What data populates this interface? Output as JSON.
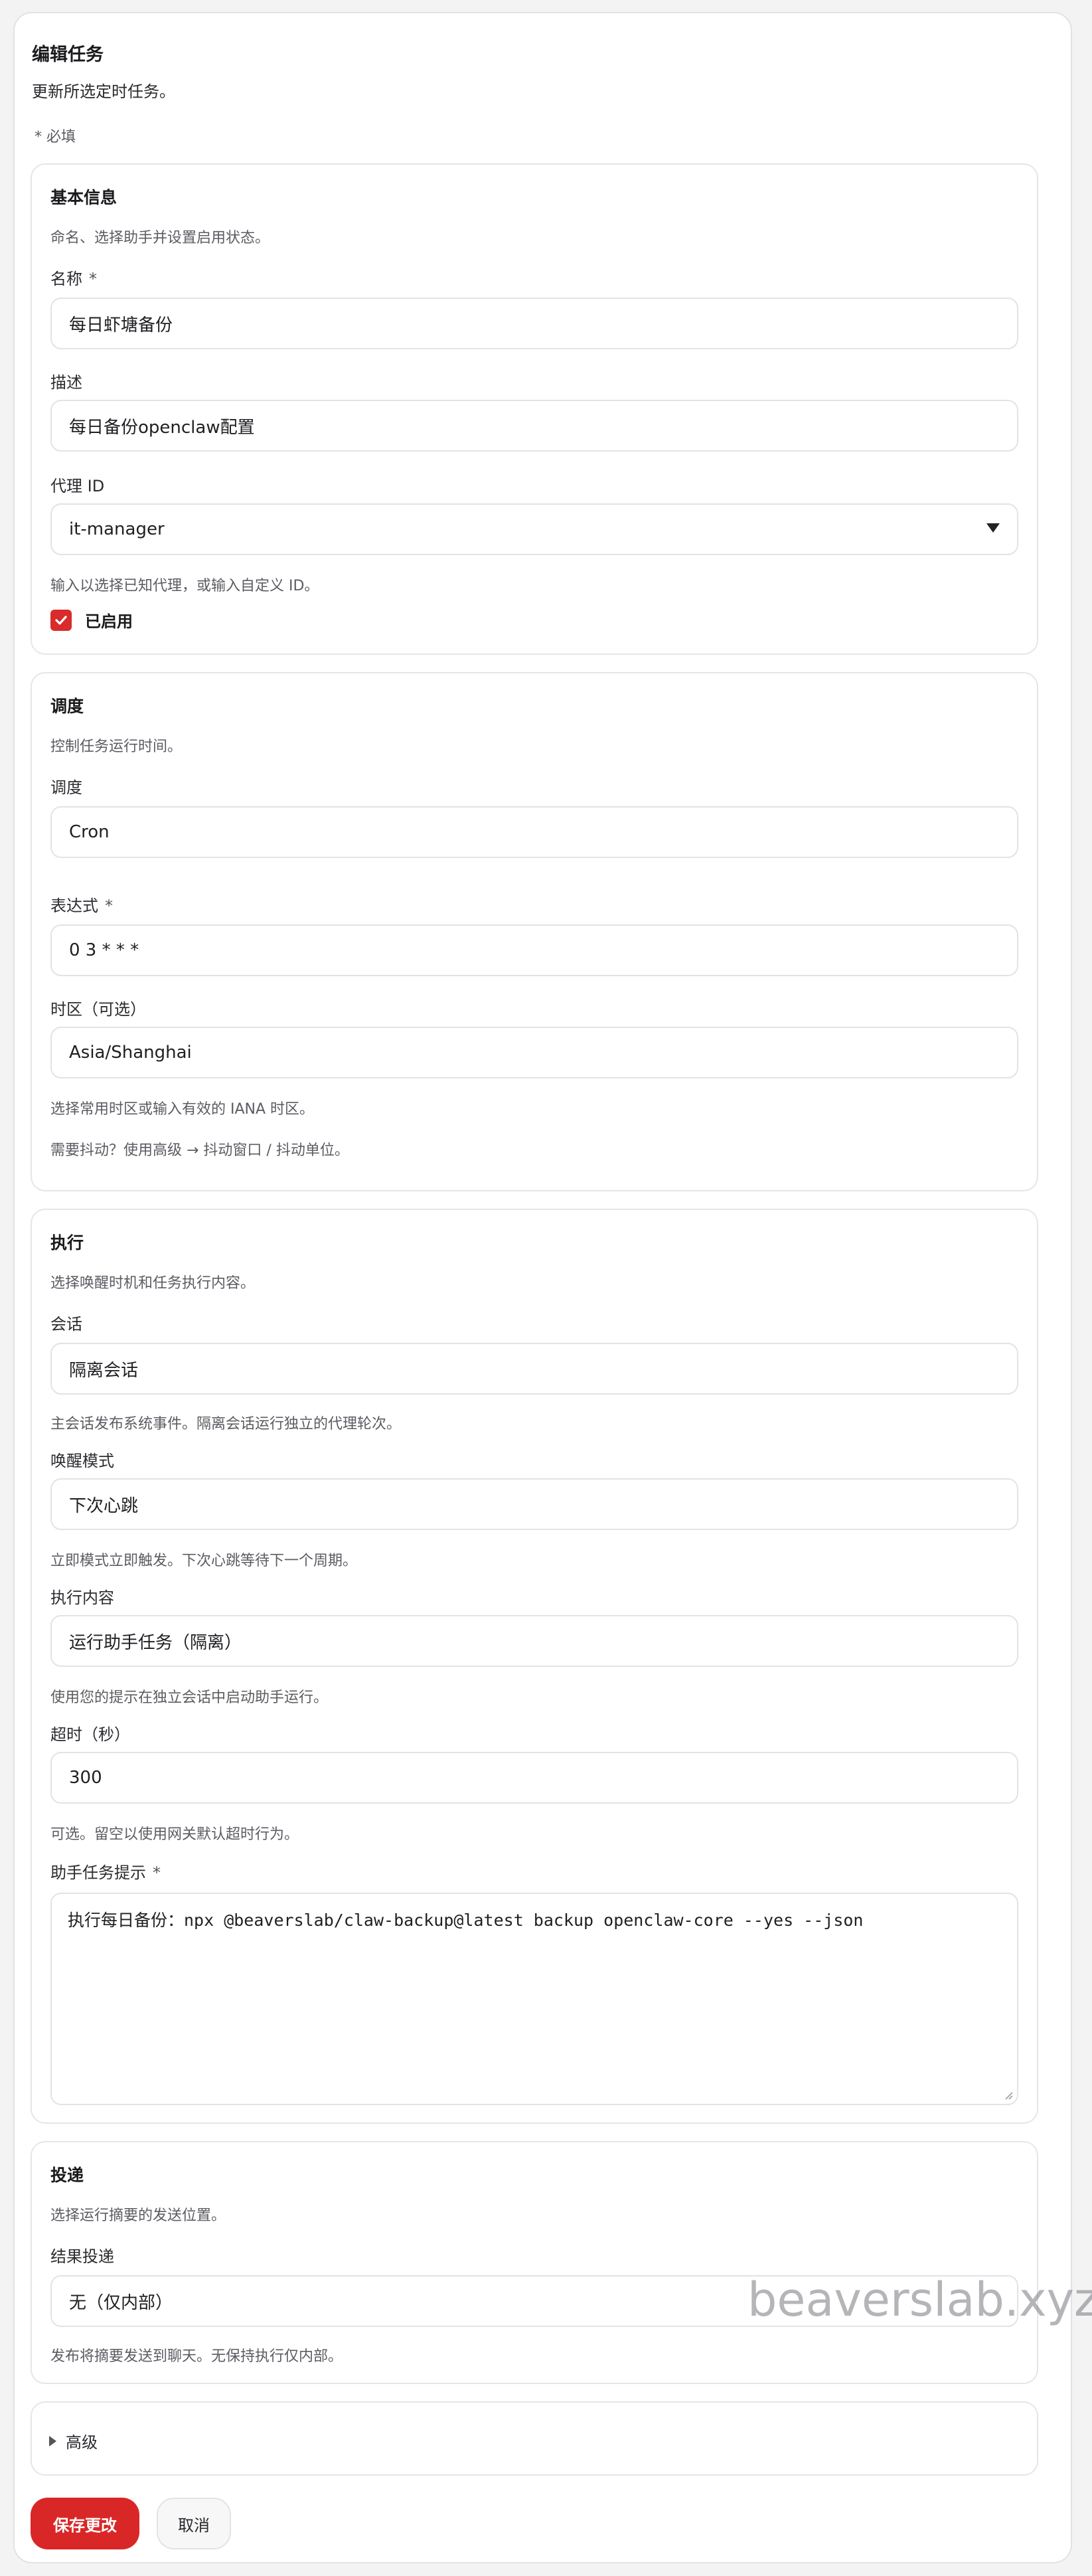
{
  "header": {
    "title": "编辑任务",
    "subtitle": "更新所选定时任务。",
    "required_note": "* 必填"
  },
  "basic": {
    "title": "基本信息",
    "description": "命名、选择助手并设置启用状态。",
    "name_label": "名称",
    "required_mark": "*",
    "name_value": "每日虾塘备份",
    "desc_label": "描述",
    "desc_value": "每日备份openclaw配置",
    "agent_label": "代理 ID",
    "agent_value": "it-manager",
    "agent_help": "输入以选择已知代理，或输入自定义 ID。",
    "enabled_label": "已启用"
  },
  "schedule": {
    "title": "调度",
    "description": "控制任务运行时间。",
    "schedule_label": "调度",
    "schedule_value": "Cron",
    "expr_label": "表达式",
    "required_mark": "*",
    "expr_value": "0 3 * * *",
    "tz_label": "时区（可选）",
    "tz_value": "Asia/Shanghai",
    "tz_help": "选择常用时区或输入有效的 IANA 时区。",
    "jitter_help": "需要抖动？使用高级 → 抖动窗口 / 抖动单位。"
  },
  "execution": {
    "title": "执行",
    "description": "选择唤醒时机和任务执行内容。",
    "session_label": "会话",
    "session_value": "隔离会话",
    "session_help": "主会话发布系统事件。隔离会话运行独立的代理轮次。",
    "wake_label": "唤醒模式",
    "wake_value": "下次心跳",
    "wake_help": "立即模式立即触发。下次心跳等待下一个周期。",
    "payload_label": "执行内容",
    "payload_value": "运行助手任务（隔离）",
    "payload_help": "使用您的提示在独立会话中启动助手运行。",
    "timeout_label": "超时（秒）",
    "timeout_value": "300",
    "timeout_help": "可选。留空以使用网关默认超时行为。",
    "prompt_label": "助手任务提示",
    "required_mark": "*",
    "prompt_value": "执行每日备份：npx @beaverslab/claw-backup@latest backup openclaw-core --yes --json"
  },
  "delivery": {
    "title": "投递",
    "description": "选择运行摘要的发送位置。",
    "result_label": "结果投递",
    "result_value": "无（仅内部）",
    "result_help": "发布将摘要发送到聊天。无保持执行仅内部。"
  },
  "advanced": {
    "label": "高级"
  },
  "actions": {
    "save_label": "保存更改",
    "cancel_label": "取消"
  },
  "watermark": "beaverslab.xyz",
  "colors": {
    "accent": "#d92727",
    "border": "#e3e3e7",
    "background": "#f3f3f4"
  }
}
